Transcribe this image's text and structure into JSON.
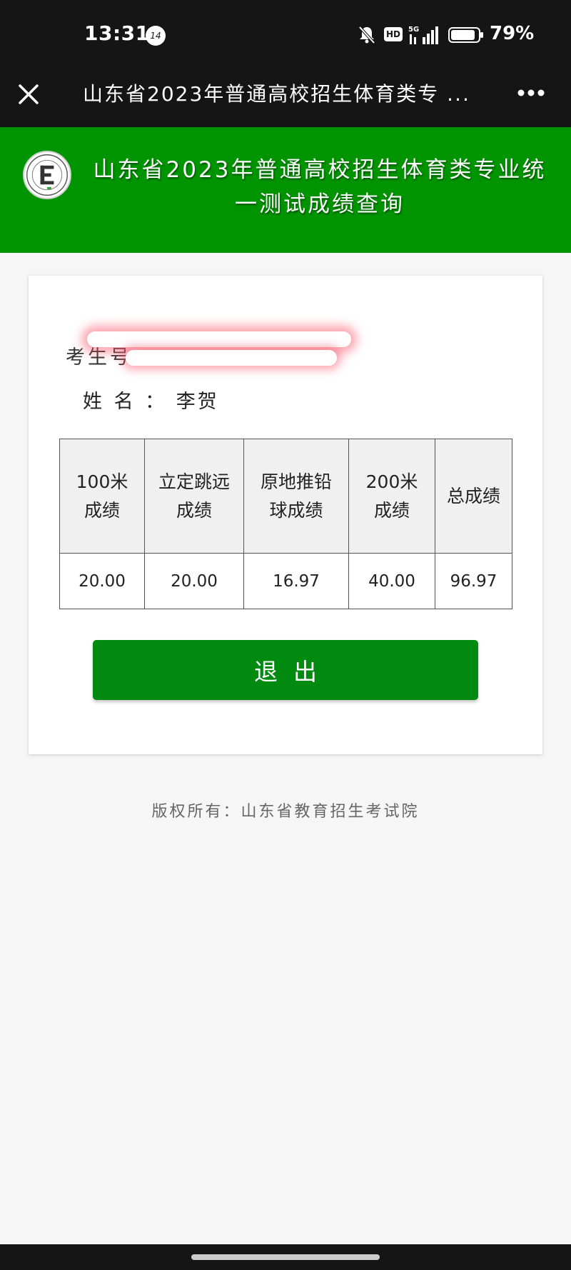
{
  "status_bar": {
    "time": "13:31",
    "notification_count": "14",
    "hd_label": "HD",
    "network_label": "5G",
    "battery": "79%"
  },
  "nav": {
    "title": "山东省2023年普通高校招生体育类专 ...",
    "icons": [
      "close-icon",
      "more-icon"
    ]
  },
  "header": {
    "title": "山东省2023年普通高校招生体育类专业统一测试成绩查询"
  },
  "candidate": {
    "exam_number_label": "考生号",
    "name_label": "姓 名 ：",
    "name_value": "李贺"
  },
  "score_table": {
    "headers": [
      "100米成绩",
      "立定跳远成绩",
      "原地推铅球成绩",
      "200米成绩",
      "总成绩"
    ],
    "values": [
      "20.00",
      "20.00",
      "16.97",
      "40.00",
      "96.97"
    ]
  },
  "actions": {
    "exit_label": "退出"
  },
  "footer": {
    "copyright": "版权所有：山东省教育招生考试院"
  },
  "colors": {
    "brand_green": "#009400",
    "button_green": "#008a10",
    "dark_bar": "#151515"
  }
}
